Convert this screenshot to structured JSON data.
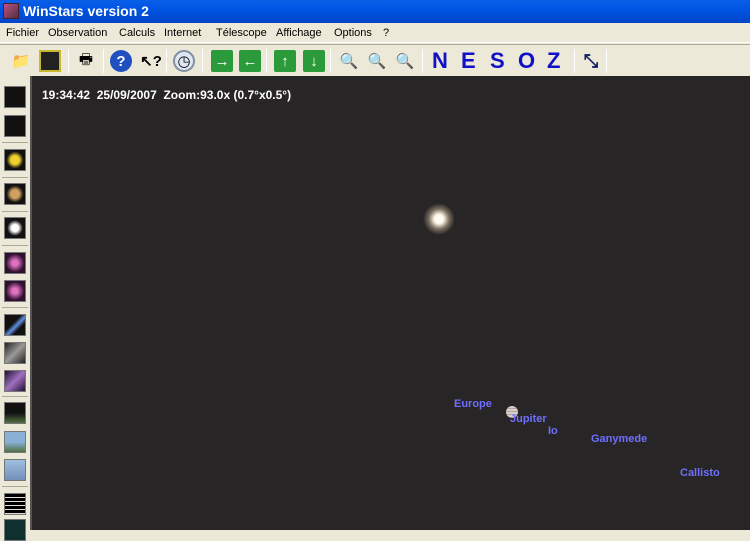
{
  "window": {
    "title": "WinStars version 2"
  },
  "menu": [
    "Fichier",
    "Observation",
    "Calculs",
    "Internet",
    "Télescope",
    "Affichage",
    "Options",
    "?"
  ],
  "toolbar": {
    "directions": [
      "N",
      "E",
      "S",
      "O",
      "Z"
    ]
  },
  "sky": {
    "time": "19:34:42",
    "date": "25/09/2007",
    "zoom": "Zoom:93.0x (0.7°x0.5°)",
    "labels": {
      "europe": "Europe",
      "jupiter": "Jupiter",
      "io": "Io",
      "ganymede": "Ganymede",
      "callisto": "Callisto"
    }
  },
  "colors": {
    "sky": "#282526",
    "label": "#6f6fff",
    "direction": "#1010c8"
  }
}
